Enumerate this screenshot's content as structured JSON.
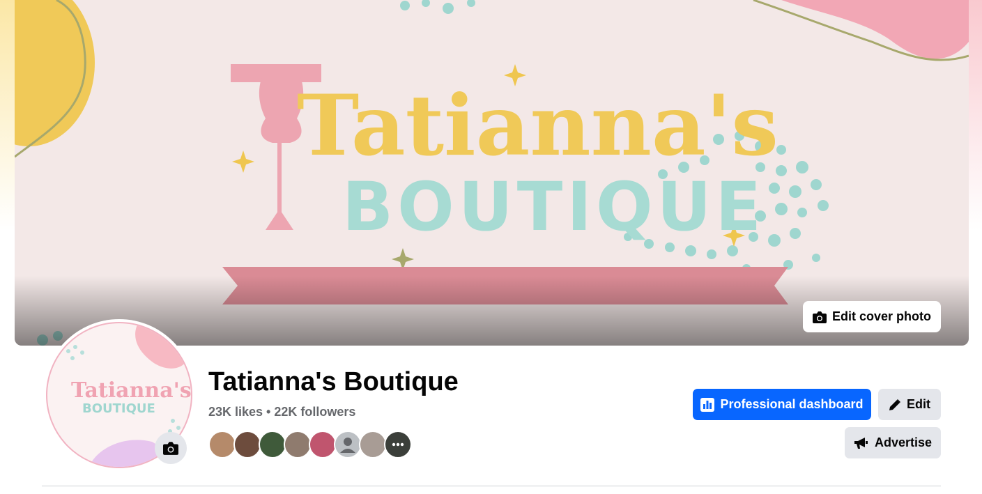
{
  "cover": {
    "logo_line1": "Tatianna's",
    "logo_line2": "BOUTIQUE",
    "edit_cover_label": "Edit cover photo",
    "edit_cover_icon": "camera-icon"
  },
  "profile": {
    "logo_line1": "Tatianna's",
    "logo_line2": "BOUTIQUE",
    "camera_icon": "camera-icon"
  },
  "page": {
    "name": "Tatianna's Boutique",
    "stats": "23K likes • 22K followers"
  },
  "followers": {
    "avatars": [
      {
        "color": "#b58a6a"
      },
      {
        "color": "#6d4c3d"
      },
      {
        "color": "#3f5a3a"
      },
      {
        "color": "#8f7b6e"
      },
      {
        "color": "#c0556e"
      },
      {
        "color": "#bcc0c4"
      },
      {
        "color": "#a89c95"
      },
      {
        "color": "#3b3f3a"
      }
    ]
  },
  "actions": {
    "dashboard_label": "Professional dashboard",
    "dashboard_icon": "dashboard-chart-icon",
    "edit_label": "Edit",
    "edit_icon": "pencil-icon",
    "advertise_label": "Advertise",
    "advertise_icon": "megaphone-icon"
  },
  "colors": {
    "primary": "#0866ff",
    "secondary_button": "#e4e6eb",
    "text": "#050505",
    "muted_text": "#65676b"
  }
}
